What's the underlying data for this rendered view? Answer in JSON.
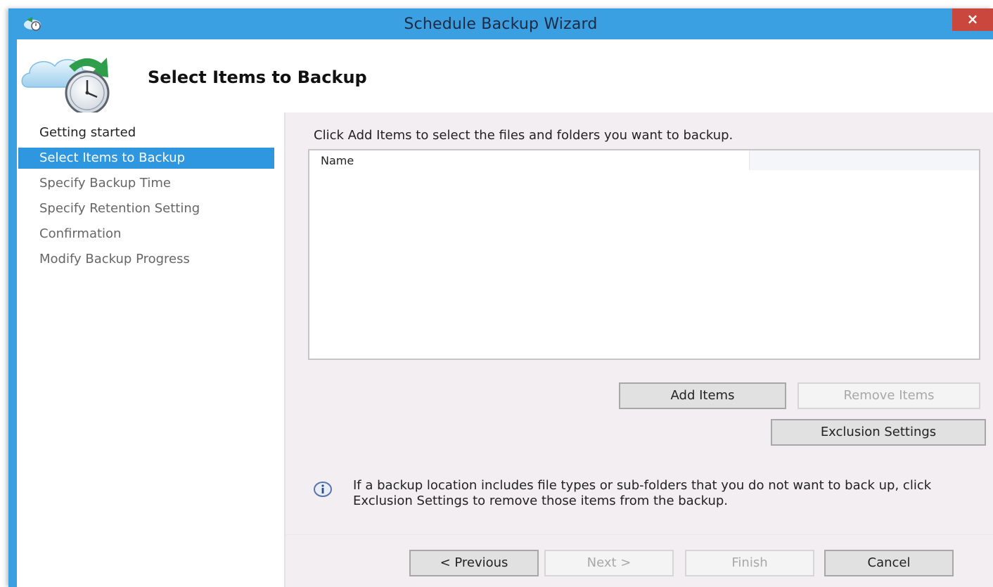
{
  "window": {
    "title": "Schedule Backup Wizard",
    "close_label": "×",
    "title_icon": "backup-icon",
    "accent": "#3aa0e2"
  },
  "header": {
    "title": "Select Items to Backup",
    "icon": "cloud-clock-icon"
  },
  "nav": {
    "items": [
      {
        "label": "Getting started",
        "state": "done"
      },
      {
        "label": "Select Items to Backup",
        "state": "active"
      },
      {
        "label": "Specify Backup Time",
        "state": "pending"
      },
      {
        "label": "Specify Retention Setting",
        "state": "pending"
      },
      {
        "label": "Confirmation",
        "state": "pending"
      },
      {
        "label": "Modify Backup Progress",
        "state": "pending"
      }
    ],
    "active_color": "#2f97df"
  },
  "content": {
    "instruction": "Click Add Items to select the files and folders you want to backup.",
    "list_columns": [
      "Name"
    ],
    "list_rows": [],
    "add_items_label": "Add Items",
    "remove_items_label": "Remove Items",
    "exclusion_settings_label": "Exclusion Settings",
    "info_icon": "info-icon",
    "info_text": "If a backup location includes file types or sub-folders that you do not want to back up, click Exclusion Settings to remove those items from the backup."
  },
  "footer": {
    "previous_label": "< Previous",
    "next_label": "Next >",
    "finish_label": "Finish",
    "cancel_label": "Cancel"
  }
}
